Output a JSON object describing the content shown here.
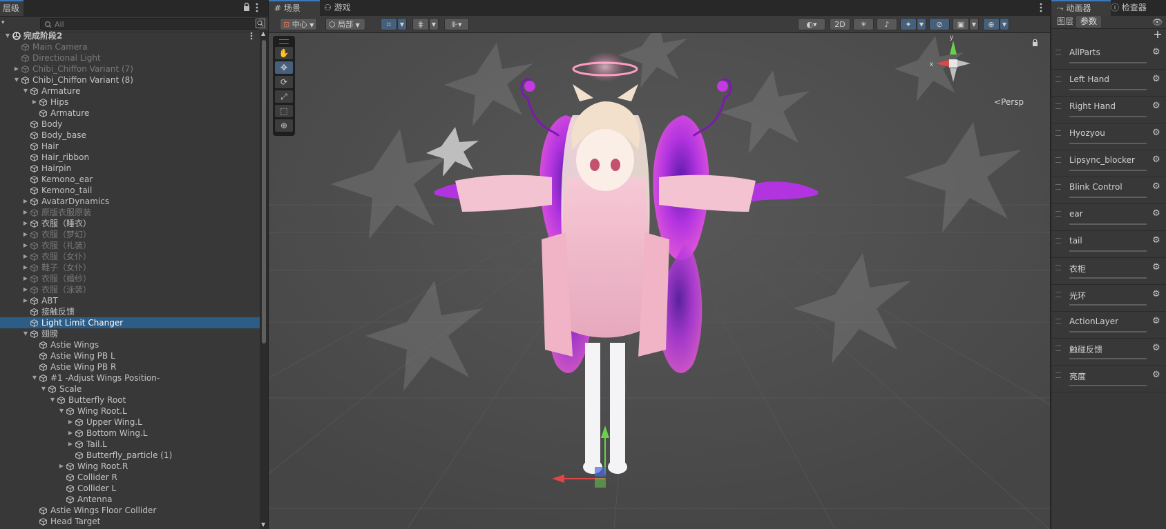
{
  "hierarchy": {
    "tab_label": "层级",
    "search_placeholder": "All",
    "rows": [
      {
        "label": "完成阶段2",
        "depth": 0,
        "arrow": "open",
        "icon": "unity",
        "dim": false,
        "bold": true
      },
      {
        "label": "Main Camera",
        "depth": 1,
        "arrow": "none",
        "icon": "cube",
        "dim": true
      },
      {
        "label": "Directional Light",
        "depth": 1,
        "arrow": "none",
        "icon": "cube",
        "dim": true
      },
      {
        "label": "Chibi_Chiffon Variant (7)",
        "depth": 1,
        "arrow": "closed",
        "icon": "cube",
        "dim": true
      },
      {
        "label": "Chibi_Chiffon Variant (8)",
        "depth": 1,
        "arrow": "open",
        "icon": "cube",
        "dim": false
      },
      {
        "label": "Armature",
        "depth": 2,
        "arrow": "open",
        "icon": "cube",
        "dim": false
      },
      {
        "label": "Hips",
        "depth": 3,
        "arrow": "closed",
        "icon": "cube",
        "dim": false
      },
      {
        "label": "Armature",
        "depth": 3,
        "arrow": "none",
        "icon": "cube",
        "dim": false
      },
      {
        "label": "Body",
        "depth": 2,
        "arrow": "none",
        "icon": "cube",
        "dim": false
      },
      {
        "label": "Body_base",
        "depth": 2,
        "arrow": "none",
        "icon": "cube",
        "dim": false
      },
      {
        "label": "Hair",
        "depth": 2,
        "arrow": "none",
        "icon": "cube",
        "dim": false
      },
      {
        "label": "Hair_ribbon",
        "depth": 2,
        "arrow": "none",
        "icon": "cube",
        "dim": false
      },
      {
        "label": "Hairpin",
        "depth": 2,
        "arrow": "none",
        "icon": "cube",
        "dim": false
      },
      {
        "label": "Kemono_ear",
        "depth": 2,
        "arrow": "none",
        "icon": "cube",
        "dim": false
      },
      {
        "label": "Kemono_tail",
        "depth": 2,
        "arrow": "none",
        "icon": "cube",
        "dim": false
      },
      {
        "label": "AvatarDynamics",
        "depth": 2,
        "arrow": "closed",
        "icon": "cube",
        "dim": false
      },
      {
        "label": "原版衣服原装",
        "depth": 2,
        "arrow": "closed",
        "icon": "cube",
        "dim": true
      },
      {
        "label": "衣服（睡衣）",
        "depth": 2,
        "arrow": "closed",
        "icon": "cube",
        "dim": false
      },
      {
        "label": "衣服（梦幻）",
        "depth": 2,
        "arrow": "closed",
        "icon": "cube",
        "dim": true
      },
      {
        "label": "衣服（礼装）",
        "depth": 2,
        "arrow": "closed",
        "icon": "cube",
        "dim": true
      },
      {
        "label": "衣服（女仆）",
        "depth": 2,
        "arrow": "closed",
        "icon": "cube",
        "dim": true
      },
      {
        "label": "鞋子（女仆）",
        "depth": 2,
        "arrow": "closed",
        "icon": "cube",
        "dim": true
      },
      {
        "label": "衣服（婚纱）",
        "depth": 2,
        "arrow": "closed",
        "icon": "cube",
        "dim": true
      },
      {
        "label": "衣服（泳装）",
        "depth": 2,
        "arrow": "closed",
        "icon": "cube",
        "dim": true
      },
      {
        "label": "ABT",
        "depth": 2,
        "arrow": "closed",
        "icon": "cube",
        "dim": false
      },
      {
        "label": "接触反馈",
        "depth": 2,
        "arrow": "none",
        "icon": "cube",
        "dim": false
      },
      {
        "label": "Light Limit Changer",
        "depth": 2,
        "arrow": "none",
        "icon": "cube",
        "dim": false,
        "selected": true
      },
      {
        "label": "翅膀",
        "depth": 2,
        "arrow": "open",
        "icon": "cube",
        "dim": false
      },
      {
        "label": "Astie Wings",
        "depth": 3,
        "arrow": "none",
        "icon": "cube",
        "dim": false
      },
      {
        "label": "Astie Wing PB L",
        "depth": 3,
        "arrow": "none",
        "icon": "cube",
        "dim": false
      },
      {
        "label": "Astie Wing PB R",
        "depth": 3,
        "arrow": "none",
        "icon": "cube",
        "dim": false
      },
      {
        "label": "#1 -Adjust Wings Position-",
        "depth": 3,
        "arrow": "open",
        "icon": "cube",
        "dim": false
      },
      {
        "label": "Scale",
        "depth": 4,
        "arrow": "open",
        "icon": "cube",
        "dim": false
      },
      {
        "label": "Butterfly Root",
        "depth": 5,
        "arrow": "open",
        "icon": "cube",
        "dim": false
      },
      {
        "label": "Wing Root.L",
        "depth": 6,
        "arrow": "open",
        "icon": "cube",
        "dim": false
      },
      {
        "label": "Upper Wing.L",
        "depth": 7,
        "arrow": "closed",
        "icon": "cube",
        "dim": false
      },
      {
        "label": "Bottom Wing.L",
        "depth": 7,
        "arrow": "closed",
        "icon": "cube",
        "dim": false
      },
      {
        "label": "Tail.L",
        "depth": 7,
        "arrow": "closed",
        "icon": "cube",
        "dim": false
      },
      {
        "label": "Butterfly_particle (1)",
        "depth": 7,
        "arrow": "none",
        "icon": "cube",
        "dim": false
      },
      {
        "label": "Wing Root.R",
        "depth": 6,
        "arrow": "closed",
        "icon": "cube",
        "dim": false
      },
      {
        "label": "Collider R",
        "depth": 6,
        "arrow": "none",
        "icon": "cube",
        "dim": false
      },
      {
        "label": "Collider L",
        "depth": 6,
        "arrow": "none",
        "icon": "cube",
        "dim": false
      },
      {
        "label": "Antenna",
        "depth": 6,
        "arrow": "none",
        "icon": "cube",
        "dim": false
      },
      {
        "label": "Astie Wings Floor Collider",
        "depth": 3,
        "arrow": "none",
        "icon": "cube",
        "dim": false
      },
      {
        "label": "Head Target",
        "depth": 3,
        "arrow": "none",
        "icon": "cube",
        "dim": false
      }
    ]
  },
  "scene": {
    "tab_scene": "场景",
    "tab_game": "游戏",
    "pivot_label": "中心",
    "space_label": "局部",
    "mode_2d": "2D",
    "persp_label": "Persp"
  },
  "animator": {
    "tab_animator": "动画器",
    "tab_inspector": "检查器",
    "subtab_layers": "图层",
    "subtab_params": "参数",
    "add_label": "+",
    "params": [
      "AllParts",
      "Left Hand",
      "Right Hand",
      "Hyozyou",
      "Lipsync_blocker",
      "Blink Control",
      "ear",
      "tail",
      "衣柜",
      "光环",
      "ActionLayer",
      "触碰反馈",
      "亮度"
    ]
  },
  "colors": {
    "selection": "#2c5d87",
    "accent_blue": "#3a79bb",
    "toggle_on": "#46607c",
    "gizmo_x": "#e04646",
    "gizmo_y": "#6ad14a",
    "gizmo_z": "#4a6ae0",
    "wing_purple": "#a82ad8",
    "dress_pink": "#f2b6c8"
  }
}
